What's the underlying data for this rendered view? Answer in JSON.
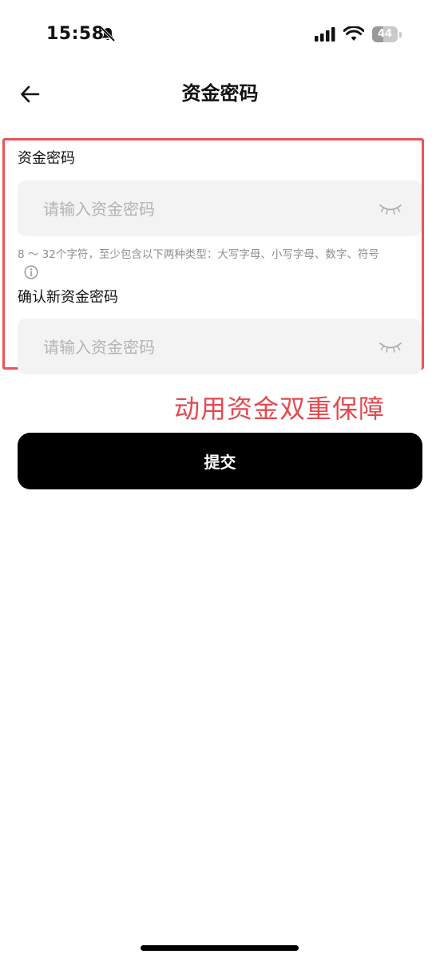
{
  "status_bar": {
    "time": "15:58",
    "battery_text": "44",
    "battery_level": 0.44,
    "icons": [
      "bell-muted-icon",
      "cellular-signal-icon",
      "wifi-icon",
      "battery-icon"
    ]
  },
  "header": {
    "title": "资金密码",
    "back_icon": "arrow-left-icon"
  },
  "form": {
    "password_label": "资金密码",
    "password_placeholder": "请输入资金密码",
    "password_hint": "8 ～ 32个字符，至少包含以下两种类型：大写字母、小写字母、数字、符号",
    "confirm_label": "确认新资金密码",
    "confirm_placeholder": "请输入资金密码",
    "toggle_icon": "eye-closed-icon",
    "info_icon": "info-icon",
    "frame_color": "#e9545a"
  },
  "annotation": {
    "text": "动用资金双重保障",
    "color": "#e34a50"
  },
  "submit_label": "提交"
}
